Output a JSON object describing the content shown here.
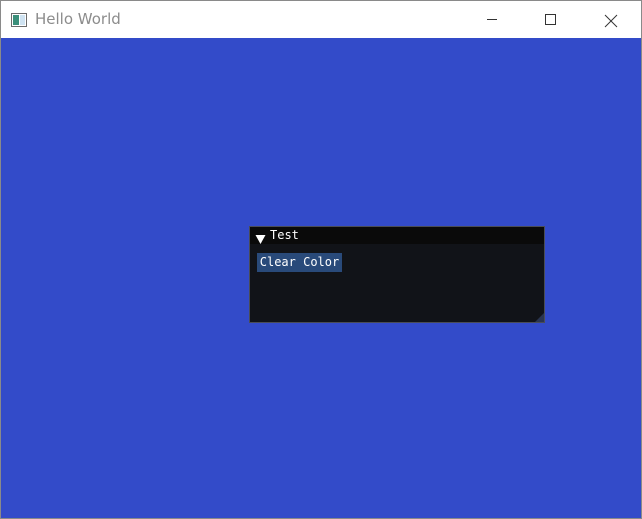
{
  "window": {
    "title": "Hello World",
    "icon": "app-window-icon",
    "controls": {
      "minimize_icon": "minimize-icon",
      "maximize_icon": "maximize-icon",
      "close_icon": "close-icon"
    }
  },
  "canvas": {
    "clear_color": "#334bc9"
  },
  "imgui_panel": {
    "title": "Test",
    "collapse_icon": "collapse-arrow-icon",
    "button_label": "Clear Color",
    "accent": "#294a7a"
  }
}
